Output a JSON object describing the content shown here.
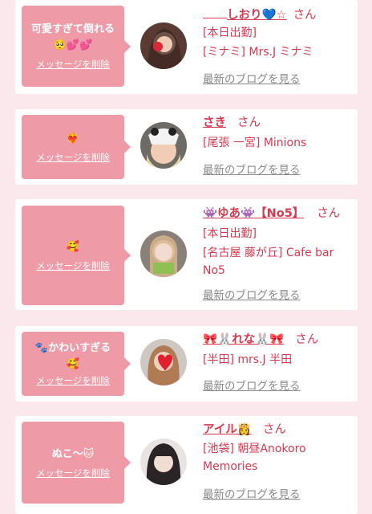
{
  "cards": [
    {
      "message": "可愛すぎて倒れる🥺💕💕",
      "delete_label": "メッセージを削除",
      "name": "しおり💙☆",
      "san": "さん",
      "detail1": "[本日出勤]",
      "detail2": "[ミナミ] Mrs.J ミナミ",
      "blog": "最新のブログを見る"
    },
    {
      "message": "❤️‍🔥",
      "delete_label": "メッセージを削除",
      "name": "さき",
      "san": "さん",
      "detail1": "[尾張 一宮] Minions",
      "blog": "最新のブログを見る"
    },
    {
      "message": "🥰",
      "delete_label": "メッセージを削除",
      "name": "👾ゆあ👾【No5】",
      "san": "さん",
      "detail1": "[本日出勤]",
      "detail2": "[名古屋 藤が丘] Cafe bar No5",
      "blog": "最新のブログを見る"
    },
    {
      "message": "🐾かわいすぎる🥰",
      "delete_label": "メッセージを削除",
      "name": "🎀🐰れな🐰🎀",
      "san": "さん",
      "detail1": "[半田] mrs.J 半田",
      "blog": "最新のブログを見る"
    },
    {
      "message": "ぬこ〜🐱",
      "delete_label": "メッセージを削除",
      "name": "アイル👸",
      "san": "さん",
      "detail1": "[池袋] 朝昼Anokoro Memories",
      "blog": "最新のブログを見る"
    }
  ]
}
